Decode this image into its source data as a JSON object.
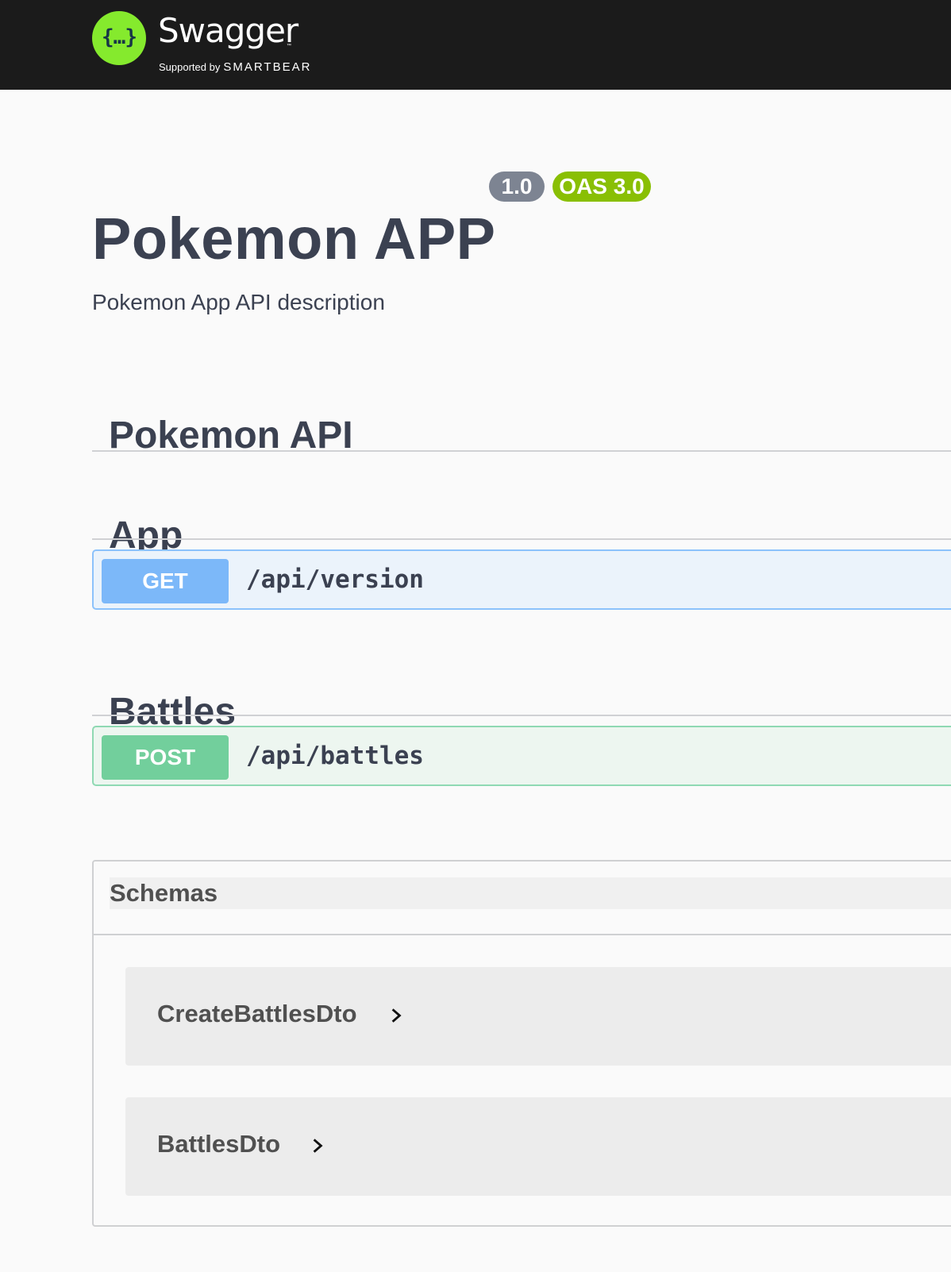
{
  "topbar": {
    "logo_icon": "swagger-braces-icon",
    "logo_glyph": "{…}",
    "brand": "Swagger",
    "tm": "™",
    "supported_by": "Supported by",
    "smartbear": "SMARTBEAR"
  },
  "info": {
    "title": "Pokemon APP",
    "version": "1.0",
    "oas": "OAS 3.0",
    "description": "Pokemon App API description"
  },
  "sections": {
    "api_title": "Pokemon API",
    "app_title": "App",
    "battles_title": "Battles"
  },
  "operations": [
    {
      "method": "GET",
      "path": "/api/version",
      "color": "#61affe"
    },
    {
      "method": "POST",
      "path": "/api/battles",
      "color": "#49cc90"
    }
  ],
  "schemas": {
    "title": "Schemas",
    "models": [
      {
        "name": "CreateBattlesDto",
        "icon": "chevron-right-icon"
      },
      {
        "name": "BattlesDto",
        "icon": "chevron-right-icon"
      }
    ]
  },
  "colors": {
    "topbar": "#1b1b1b",
    "logo_green": "#85ea2d",
    "version_badge": "#7d8492",
    "oas_badge": "#89bf04"
  }
}
